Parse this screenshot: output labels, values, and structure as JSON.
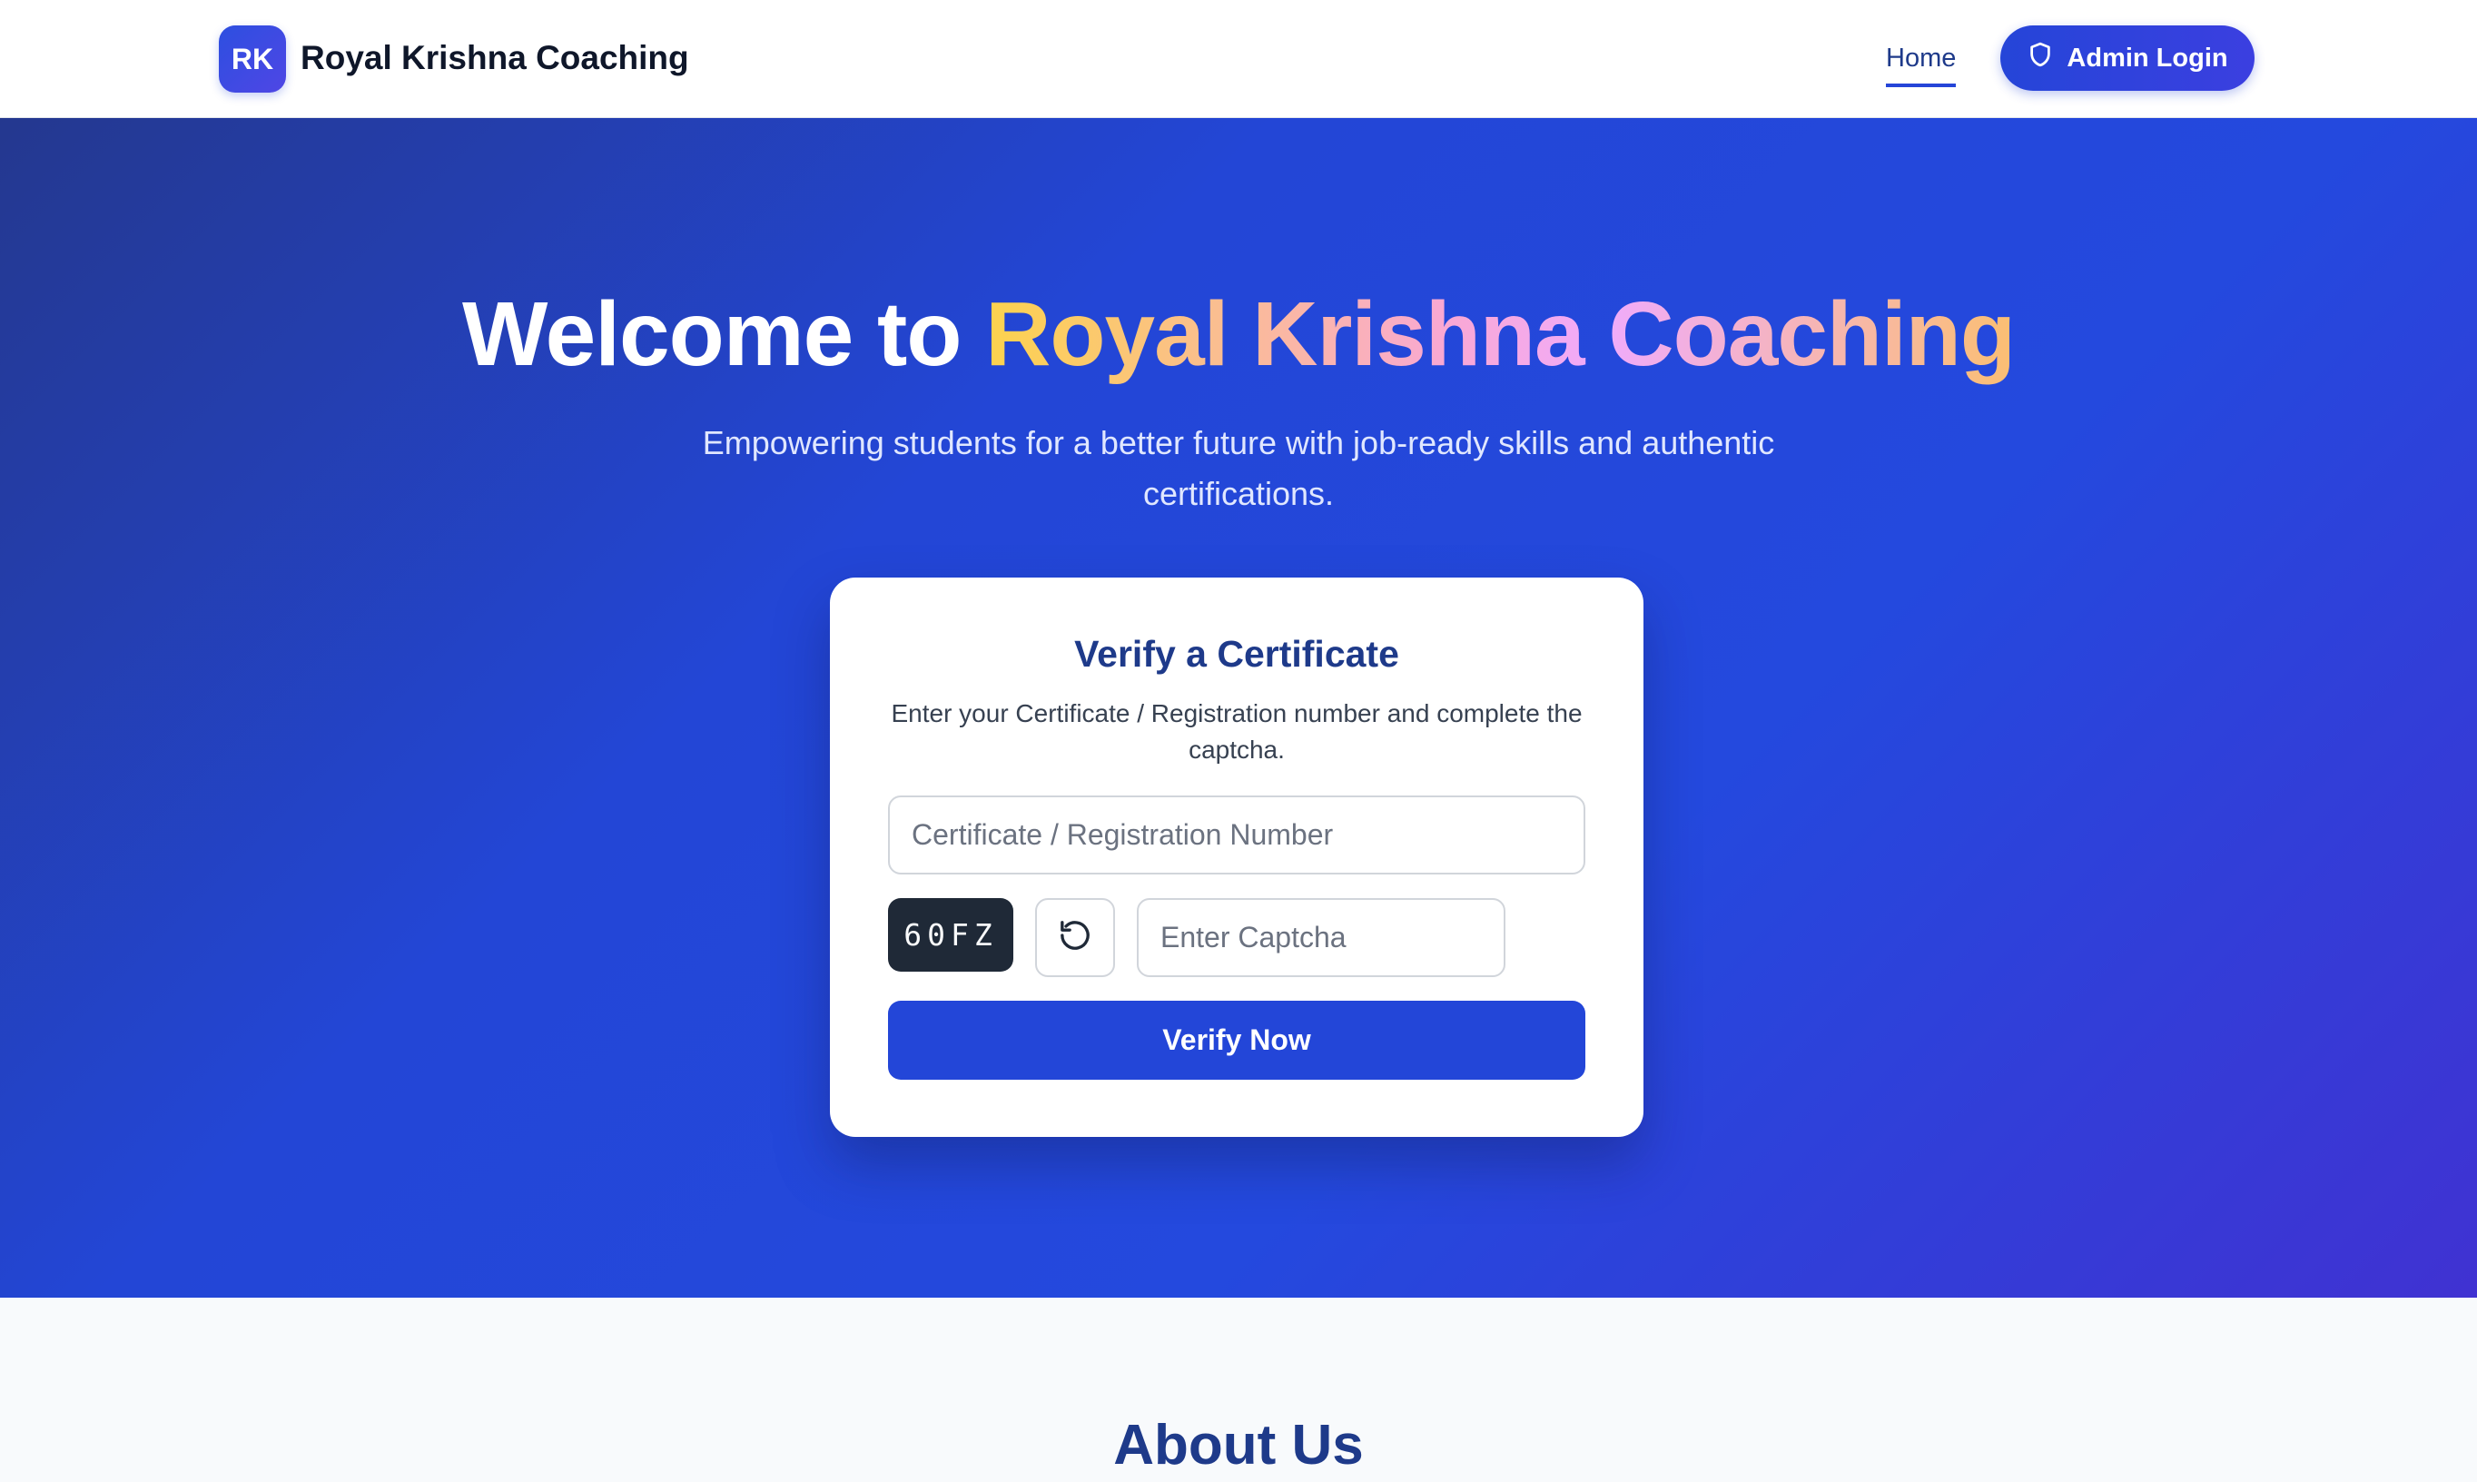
{
  "navbar": {
    "logo_initials": "RK",
    "brand_name": "Royal Krishna Coaching",
    "home_link": "Home",
    "admin_login_label": "Admin Login"
  },
  "hero": {
    "title_prefix": "Welcome to ",
    "title_highlight": "Royal Krishna Coaching",
    "subtitle": "Empowering students for a better future with job-ready skills and authentic certifications."
  },
  "verify_card": {
    "title": "Verify a Certificate",
    "description": "Enter your Certificate / Registration number and complete the captcha.",
    "certificate_input_placeholder": "Certificate / Registration Number",
    "captcha_code": "60FZ",
    "refresh_icon": "refresh-icon",
    "captcha_input_placeholder": "Enter Captcha",
    "verify_button_label": "Verify Now"
  },
  "about": {
    "title": "About Us"
  },
  "colors": {
    "primary": "#2346d8",
    "heading_navy": "#1e3a8a",
    "captcha_bg": "#1f2937"
  }
}
